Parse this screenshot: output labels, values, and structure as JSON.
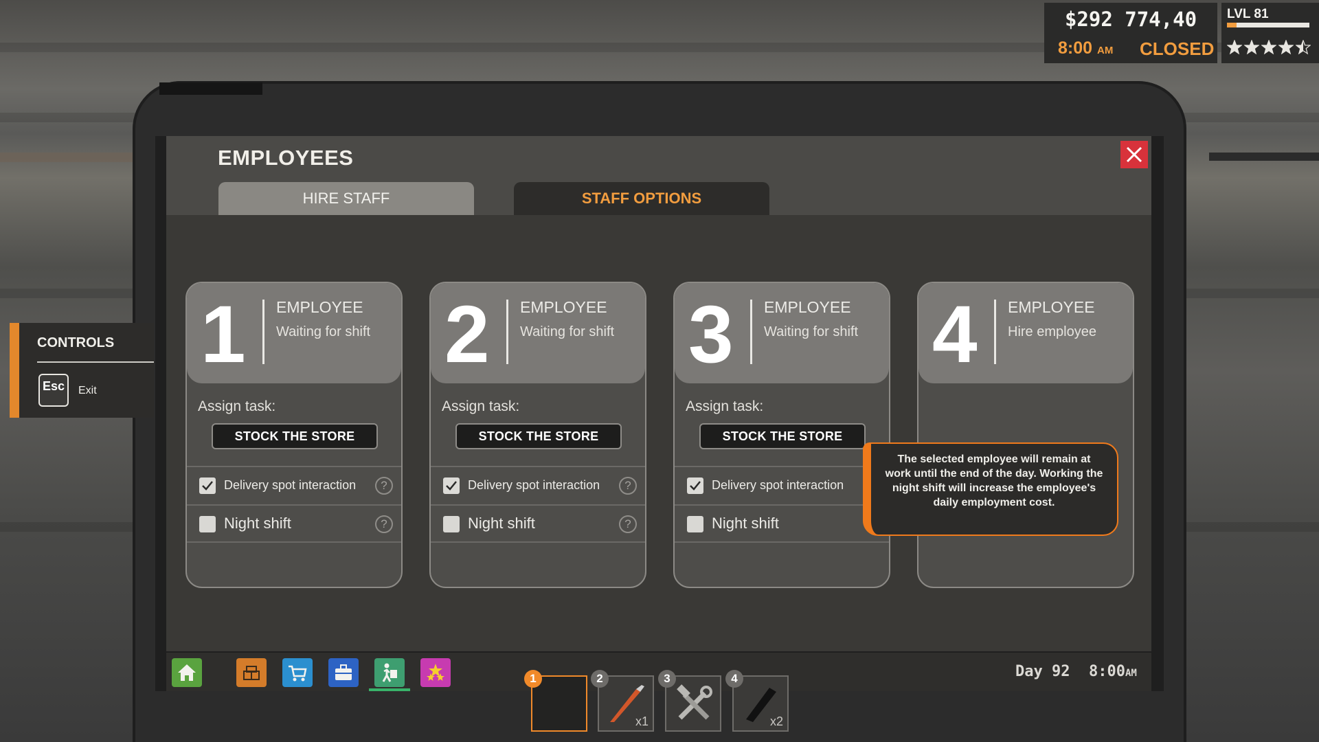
{
  "hud": {
    "money": "$292 774,40",
    "clock": "8:00",
    "clock_suffix": "AM",
    "store_status": "CLOSED",
    "level": "LVL 81",
    "xp_fraction": 0.12,
    "rating_stars": 4.5
  },
  "controls": {
    "title": "CONTROLS",
    "key": "Esc",
    "action": "Exit"
  },
  "panel": {
    "title": "EMPLOYEES",
    "tabs": [
      {
        "label": "HIRE STAFF",
        "active": false
      },
      {
        "label": "STAFF OPTIONS",
        "active": true
      }
    ]
  },
  "employees": [
    {
      "number": "1",
      "role": "EMPLOYEE",
      "status": "Waiting for shift",
      "assign_label": "Assign task:",
      "task": "STOCK THE STORE",
      "delivery_label": "Delivery spot interaction",
      "delivery_checked": true,
      "night_label": "Night shift",
      "night_checked": false
    },
    {
      "number": "2",
      "role": "EMPLOYEE",
      "status": "Waiting for shift",
      "assign_label": "Assign task:",
      "task": "STOCK THE STORE",
      "delivery_label": "Delivery spot interaction",
      "delivery_checked": true,
      "night_label": "Night shift",
      "night_checked": false
    },
    {
      "number": "3",
      "role": "EMPLOYEE",
      "status": "Waiting for shift",
      "assign_label": "Assign task:",
      "task": "STOCK THE STORE",
      "delivery_label": "Delivery spot interaction",
      "delivery_checked": true,
      "night_label": "Night shift",
      "night_checked": false
    },
    {
      "number": "4",
      "role": "EMPLOYEE",
      "status": "Hire employee"
    }
  ],
  "help_glyph": "?",
  "tooltip": "The selected employee will remain at work until the end of the day. Working the night shift will increase the employee's daily employment cost.",
  "taskbar": {
    "icons": [
      "home-icon",
      "boxes-icon",
      "cart-icon",
      "briefcase-icon",
      "employee-icon",
      "stars-icon"
    ],
    "day": "Day 92",
    "time": "8:00",
    "time_suffix": "AM"
  },
  "hotbar": [
    {
      "slot": "1",
      "item": "empty",
      "qty": ""
    },
    {
      "slot": "2",
      "item": "box-cutter-icon",
      "qty": "x1"
    },
    {
      "slot": "3",
      "item": "tools-icon",
      "qty": ""
    },
    {
      "slot": "4",
      "item": "pad-icon",
      "qty": "x2"
    }
  ],
  "colors": {
    "accent_orange": "#f29d3f",
    "close_red": "#d8323b",
    "tooltip_border": "#f07a1b"
  }
}
